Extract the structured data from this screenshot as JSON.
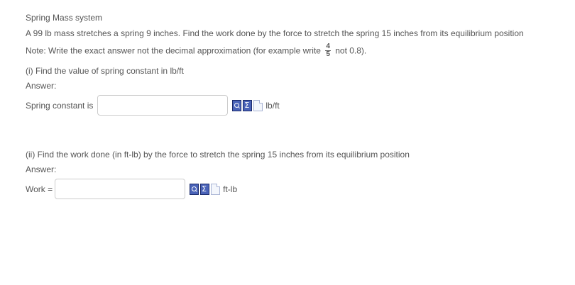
{
  "problem": {
    "title": "Spring Mass system",
    "statement": "A 99  lb mass stretches a spring 9 inches. Find the work done by the force to stretch the spring 15 inches from its equilibrium position",
    "note_prefix": "Note: Write the exact answer not the decimal approximation (for example write",
    "note_fraction_num": "4",
    "note_fraction_den": "5",
    "note_suffix": "not 0.8)."
  },
  "part1": {
    "question": "(i) Find the value of spring constant in lb/ft",
    "answer_label": "Answer:",
    "field_label": "Spring constant is",
    "value": "",
    "unit": "lb/ft",
    "tool_icons": [
      "equation-preview-icon",
      "equation-editor-icon",
      "help-document-icon"
    ]
  },
  "part2": {
    "question": "(ii) Find the work done (in ft-lb) by the force to stretch the spring 15 inches from its equilibrium position",
    "answer_label": "Answer:",
    "field_label": "Work =",
    "value": "",
    "unit": "ft-lb",
    "tool_icons": [
      "equation-preview-icon",
      "equation-editor-icon",
      "help-document-icon"
    ]
  }
}
